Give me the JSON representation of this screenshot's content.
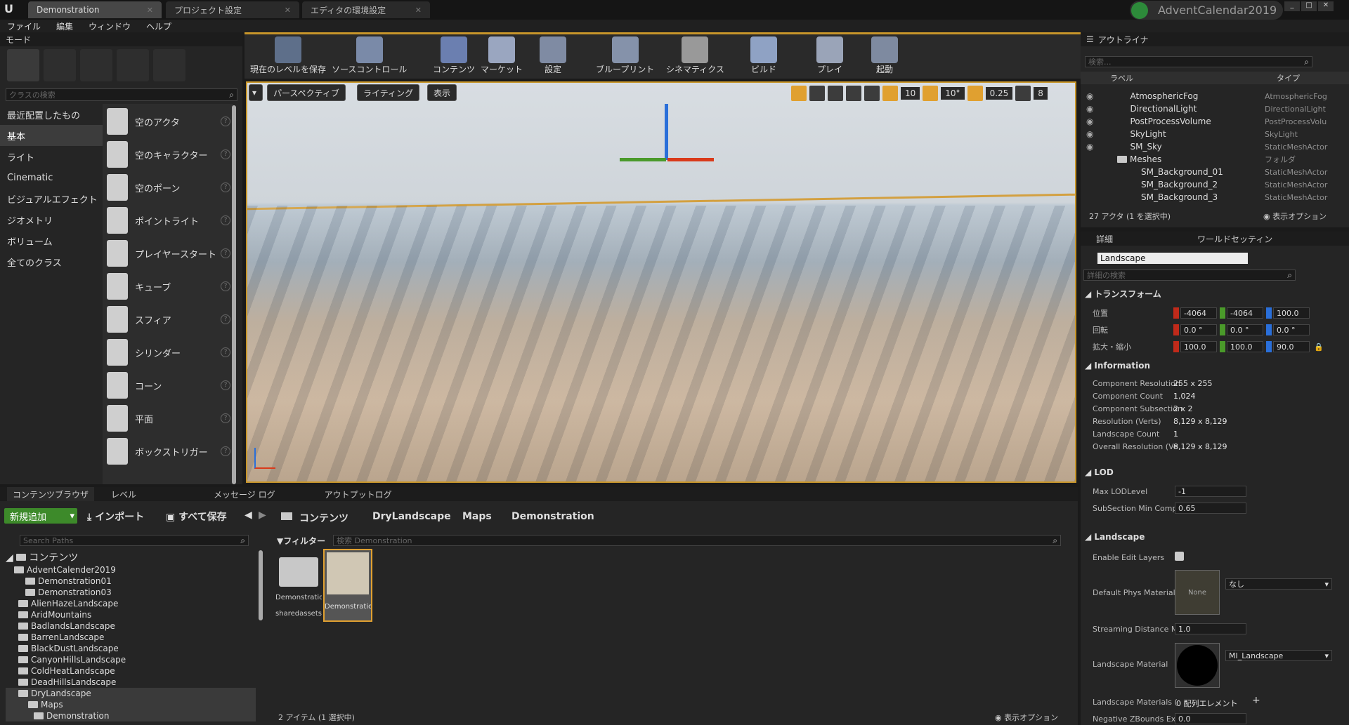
{
  "window": {
    "tabs": [
      {
        "label": "Demonstration"
      },
      {
        "label": "プロジェクト設定"
      },
      {
        "label": "エディタの環境設定"
      }
    ],
    "project_name": "AdventCalendar2019"
  },
  "menu": [
    "ファイル",
    "編集",
    "ウィンドウ",
    "ヘルプ"
  ],
  "modes": {
    "title": "モード",
    "search_placeholder": "クラスの検索",
    "categories": [
      "最近配置したもの",
      "基本",
      "ライト",
      "Cinematic",
      "ビジュアルエフェクト",
      "ジオメトリ",
      "ボリューム",
      "全てのクラス"
    ],
    "actors": [
      "空のアクタ",
      "空のキャラクター",
      "空のポーン",
      "ポイントライト",
      "プレイヤースタート",
      "キューブ",
      "スフィア",
      "シリンダー",
      "コーン",
      "平面",
      "ボックストリガー"
    ]
  },
  "toolbar": [
    "現在のレベルを保存",
    "ソースコントロール",
    "コンテンツ",
    "マーケット",
    "設定",
    "ブループリント",
    "シネマティクス",
    "ビルド",
    "プレイ",
    "起動"
  ],
  "viewport": {
    "perspective": "パースペクティブ",
    "lighting": "ライティング",
    "show": "表示",
    "grid": "10",
    "rot": "10°",
    "scale": "0.25",
    "speed": "8"
  },
  "outliner": {
    "title": "アウトライナ",
    "search_placeholder": "検索...",
    "col_label": "ラベル",
    "col_type": "タイプ",
    "rows": [
      {
        "label": "AtmosphericFog",
        "type": "AtmosphericFog"
      },
      {
        "label": "DirectionalLight",
        "type": "DirectionalLight"
      },
      {
        "label": "PostProcessVolume",
        "type": "PostProcessVolu"
      },
      {
        "label": "SkyLight",
        "type": "SkyLight"
      },
      {
        "label": "SM_Sky",
        "type": "StaticMeshActor"
      },
      {
        "label": "Meshes",
        "type": "フォルダ"
      },
      {
        "label": "SM_Background_01",
        "type": "StaticMeshActor"
      },
      {
        "label": "SM_Background_2",
        "type": "StaticMeshActor"
      },
      {
        "label": "SM_Background_3",
        "type": "StaticMeshActor"
      }
    ],
    "status": "27 アクタ (1 を選択中)",
    "view_options": "表示オプション"
  },
  "details": {
    "tab1": "詳細",
    "tab2": "ワールドセッティン",
    "name": "Landscape",
    "search_placeholder": "詳細の検索",
    "transform": {
      "title": "トランスフォーム",
      "loc_label": "位置",
      "rot_label": "回転",
      "scale_label": "拡大・縮小",
      "loc": [
        "-4064",
        "-4064",
        "100.0"
      ],
      "rot": [
        "0.0 °",
        "0.0 °",
        "0.0 °"
      ],
      "scale": [
        "100.0",
        "100.0",
        "90.0"
      ]
    },
    "info": {
      "title": "Information",
      "rows": [
        {
          "k": "Component Resolution",
          "v": "255 x 255"
        },
        {
          "k": "Component Count",
          "v": "1,024"
        },
        {
          "k": "Component Subsection",
          "v": "2 x 2"
        },
        {
          "k": "Resolution (Verts)",
          "v": "8,129 x 8,129"
        },
        {
          "k": "Landscape Count",
          "v": "1"
        },
        {
          "k": "Overall Resolution (Ve",
          "v": "8,129 x 8,129"
        }
      ]
    },
    "lod": {
      "title": "LOD",
      "max_label": "Max LODLevel",
      "max": "-1",
      "sub_label": "SubSection Min Comp",
      "sub": "0.65"
    },
    "landscape": {
      "title": "Landscape",
      "edit_layers": "Enable Edit Layers",
      "phys_label": "Default Phys Material",
      "phys_thumb": "None",
      "phys_val": "なし",
      "stream_label": "Streaming Distance M",
      "stream": "1.0",
      "mat_label": "Landscape Material",
      "mat_val": "MI_Landscape",
      "mats_label": "Landscape Materials (",
      "mats_val": "0 配列エレメント",
      "negz_label": "Negative ZBounds Ext",
      "negz": "0.0"
    }
  },
  "bottom": {
    "tabs": [
      "コンテンツブラウザ",
      "レベル",
      "メッセージ ログ",
      "アウトプットログ"
    ],
    "add_new": "新規追加",
    "import": "インポート",
    "save_all": "すべて保存",
    "crumbs": [
      "コンテンツ",
      "DryLandscape",
      "Maps",
      "Demonstration"
    ],
    "search_paths": "Search Paths",
    "filter": "フィルター",
    "search_placeholder": "検索 Demonstration",
    "tree_root": "コンテンツ",
    "tree": [
      "AdventCalender2019",
      "Demonstration01",
      "Demonstration03",
      "AlienHazeLandscape",
      "AridMountains",
      "BadlandsLandscape",
      "BarrenLandscape",
      "BlackDustLandscape",
      "CanyonHillsLandscape",
      "ColdHeatLandscape",
      "DeadHillsLandscape",
      "DryLandscape",
      "Maps",
      "Demonstration"
    ],
    "assets": [
      {
        "name": "Demonstration",
        "sub": "sharedassets"
      },
      {
        "name": "Demonstration"
      }
    ],
    "count": "2 アイテム (1 選択中)",
    "view_options": "表示オプション"
  },
  "colors": {
    "accent": "#e0a030",
    "bg": "#252525",
    "green": "#4aa02c"
  }
}
